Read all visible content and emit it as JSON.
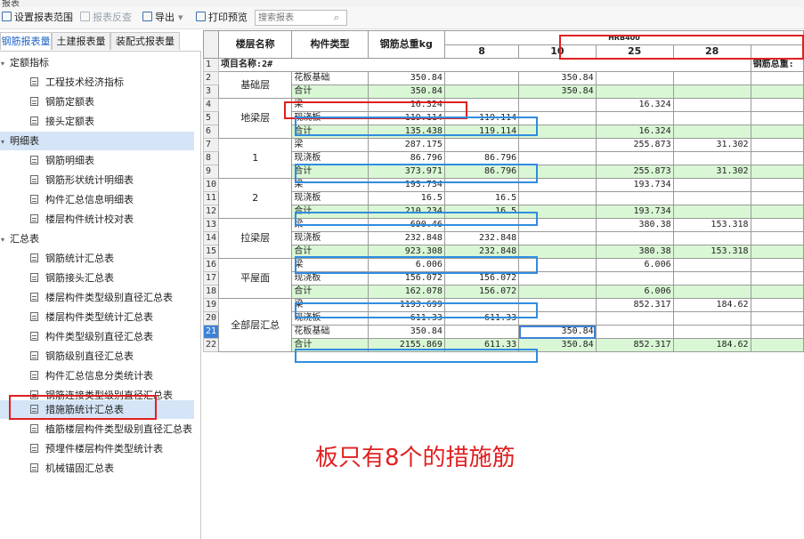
{
  "window": {
    "title": "报表"
  },
  "toolbar": {
    "set_range": "设置报表范围",
    "reverse_check": "报表反查",
    "export": "导出",
    "print_preview": "打印预览",
    "search_placeholder": "搜索报表",
    "search_icon_glyph": "⌕"
  },
  "tabs": [
    "钢筋报表量",
    "土建报表量",
    "装配式报表量"
  ],
  "tree": {
    "groups": [
      "定额指标",
      "明细表",
      "汇总表"
    ],
    "quota": [
      "工程技术经济指标",
      "钢筋定额表",
      "接头定额表"
    ],
    "detail": [
      "钢筋明细表",
      "钢筋形状统计明细表",
      "构件汇总信息明细表",
      "楼层构件统计校对表"
    ],
    "summary": [
      "钢筋统计汇总表",
      "钢筋接头汇总表",
      "楼层构件类型级别直径汇总表",
      "楼层构件类型统计汇总表",
      "构件类型级别直径汇总表",
      "钢筋级别直径汇总表",
      "构件汇总信息分类统计表",
      "钢筋连接类型级别直径汇总表",
      "措施筋统计汇总表",
      "植筋楼层构件类型级别直径汇总表",
      "预埋件楼层构件类型统计表",
      "机械锚固汇总表"
    ]
  },
  "table": {
    "headers": {
      "floor": "楼层名称",
      "component": "构件类型",
      "total": "钢筋总重kg",
      "group": "HRB400"
    },
    "diameters": [
      "8",
      "10",
      "25",
      "28"
    ],
    "project_label": "项目名称:2#",
    "total_weight_label": "钢筋总重:",
    "row_numbers": [
      "1",
      "2",
      "3",
      "4",
      "5",
      "6",
      "7",
      "8",
      "9",
      "10",
      "11",
      "12",
      "13",
      "14",
      "15",
      "16",
      "17",
      "18",
      "19",
      "20",
      "21",
      "22"
    ],
    "floors": [
      "基础层",
      "地梁层",
      "1",
      "2",
      "拉梁层",
      "平屋面",
      "全部层汇总"
    ],
    "rows": [
      {
        "type": "花板基础",
        "total": "350.84",
        "d8": "",
        "d10": "350.84",
        "d25": "",
        "d28": ""
      },
      {
        "type": "合计",
        "total": "350.84",
        "d8": "",
        "d10": "350.84",
        "d25": "",
        "d28": ""
      },
      {
        "type": "梁",
        "total": "16.324",
        "d8": "",
        "d10": "",
        "d25": "16.324",
        "d28": ""
      },
      {
        "type": "现浇板",
        "total": "119.114",
        "d8": "119.114",
        "d10": "",
        "d25": "",
        "d28": ""
      },
      {
        "type": "合计",
        "total": "135.438",
        "d8": "119.114",
        "d10": "",
        "d25": "16.324",
        "d28": ""
      },
      {
        "type": "梁",
        "total": "287.175",
        "d8": "",
        "d10": "",
        "d25": "255.873",
        "d28": "31.302"
      },
      {
        "type": "现浇板",
        "total": "86.796",
        "d8": "86.796",
        "d10": "",
        "d25": "",
        "d28": ""
      },
      {
        "type": "合计",
        "total": "373.971",
        "d8": "86.796",
        "d10": "",
        "d25": "255.873",
        "d28": "31.302"
      },
      {
        "type": "梁",
        "total": "193.734",
        "d8": "",
        "d10": "",
        "d25": "193.734",
        "d28": ""
      },
      {
        "type": "现浇板",
        "total": "16.5",
        "d8": "16.5",
        "d10": "",
        "d25": "",
        "d28": ""
      },
      {
        "type": "合计",
        "total": "210.234",
        "d8": "16.5",
        "d10": "",
        "d25": "193.734",
        "d28": ""
      },
      {
        "type": "梁",
        "total": "690.46",
        "d8": "",
        "d10": "",
        "d25": "380.38",
        "d28": "153.318"
      },
      {
        "type": "现浇板",
        "total": "232.848",
        "d8": "232.848",
        "d10": "",
        "d25": "",
        "d28": ""
      },
      {
        "type": "合计",
        "total": "923.308",
        "d8": "232.848",
        "d10": "",
        "d25": "380.38",
        "d28": "153.318"
      },
      {
        "type": "梁",
        "total": "6.006",
        "d8": "",
        "d10": "",
        "d25": "6.006",
        "d28": ""
      },
      {
        "type": "现浇板",
        "total": "156.072",
        "d8": "156.072",
        "d10": "",
        "d25": "",
        "d28": ""
      },
      {
        "type": "合计",
        "total": "162.078",
        "d8": "156.072",
        "d10": "",
        "d25": "6.006",
        "d28": ""
      },
      {
        "type": "梁",
        "total": "1193.699",
        "d8": "",
        "d10": "",
        "d25": "852.317",
        "d28": "184.62"
      },
      {
        "type": "现浇板",
        "total": "611.33",
        "d8": "611.33",
        "d10": "",
        "d25": "",
        "d28": ""
      },
      {
        "type": "花板基础",
        "total": "350.84",
        "d8": "",
        "d10": "350.84",
        "d25": "",
        "d28": ""
      },
      {
        "type": "合计",
        "total": "2155.869",
        "d8": "611.33",
        "d10": "350.84",
        "d25": "852.317",
        "d28": "184.62"
      }
    ]
  },
  "annotation": "板只有8个的措施筋",
  "colors": {
    "accent": "#1e64c8",
    "sum_row": "#d9f7d4",
    "highlight_red": "#e02020",
    "highlight_blue": "#2f8de0",
    "selected": "#d5e5f7"
  }
}
